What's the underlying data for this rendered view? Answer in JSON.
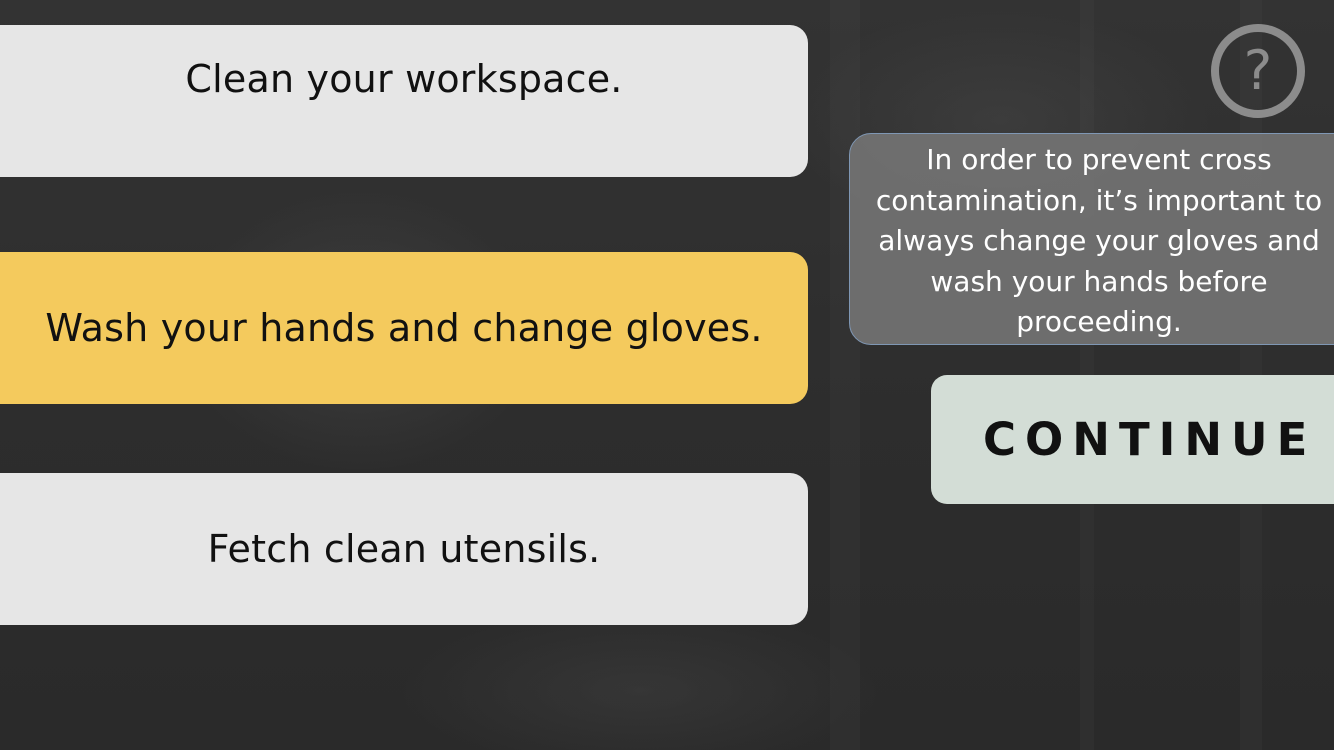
{
  "options": [
    {
      "label": "Clean your workspace.",
      "state": "default",
      "color": "#e6e6e6"
    },
    {
      "label": "Wash your hands and change gloves.",
      "state": "selected",
      "color": "#f4ca5d"
    },
    {
      "label": "Fetch clean utensils.",
      "state": "default",
      "color": "#e6e6e6"
    }
  ],
  "help": {
    "icon": "question-circle-icon",
    "glyph": "?"
  },
  "feedback": {
    "text": "In order to prevent cross contamination, it’s important to always change your gloves and wash your hands before proceeding."
  },
  "continue_button": {
    "label": "CONTINUE",
    "color": "#d3ddd6"
  }
}
